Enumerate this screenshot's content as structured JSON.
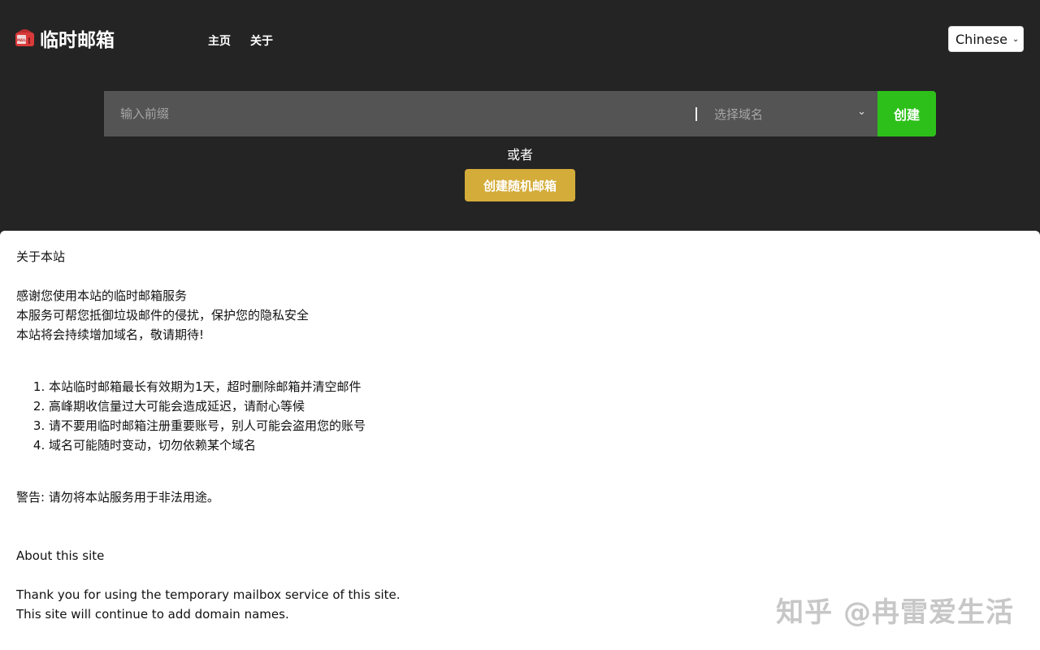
{
  "brand": {
    "name": "临时邮箱",
    "icon": "mailbox-icon"
  },
  "nav": {
    "home": "主页",
    "about": "关于"
  },
  "language": {
    "selected": "Chinese"
  },
  "create": {
    "prefix_placeholder": "输入前缀",
    "domain_placeholder": "选择域名",
    "create_label": "创建",
    "or_label": "或者",
    "random_label": "创建随机邮箱"
  },
  "about_cn": {
    "title": "关于本站",
    "lines": [
      "感谢您使用本站的临时邮箱服务",
      "本服务可帮您抵御垃圾邮件的侵扰，保护您的隐私安全",
      "本站将会持续增加域名，敬请期待!"
    ],
    "rules": [
      "本站临时邮箱最长有效期为1天，超时删除邮箱并清空邮件",
      "高峰期收信量过大可能会造成延迟，请耐心等候",
      "请不要用临时邮箱注册重要账号，别人可能会盗用您的账号",
      "域名可能随时变动，切勿依赖某个域名"
    ],
    "warning": "警告: 请勿将本站服务用于非法用途。"
  },
  "about_en": {
    "title": "About this site",
    "lines": [
      "Thank you for using the temporary mailbox service of this site.",
      "This site will continue to add domain names."
    ]
  },
  "watermark": "知乎 @冉雷爱生活",
  "colors": {
    "header_bg": "#242424",
    "input_bg": "#545454",
    "create_button": "#2ec01a",
    "random_button": "#d4ac3a"
  }
}
